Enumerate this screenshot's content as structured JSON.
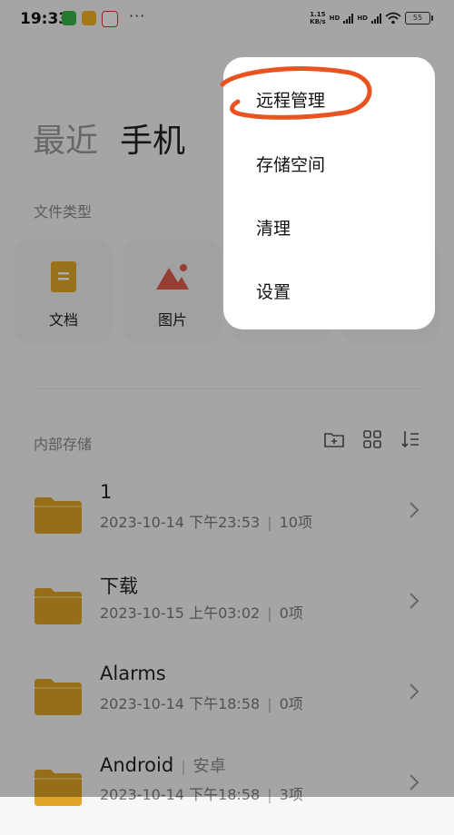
{
  "status_bar": {
    "time": "19:33",
    "more": "···",
    "speed_value": "1.15",
    "speed_unit": "KB/s",
    "hd1": "HD",
    "hd2": "HD",
    "battery": "55",
    "app_icons": [
      "wechat-icon",
      "notes-app-icon",
      "taobao-icon"
    ]
  },
  "nav": {
    "tabs": [
      "最近",
      "手机"
    ],
    "active_index": 1
  },
  "file_types": {
    "label": "文件类型",
    "items": [
      {
        "label": "文档",
        "icon": "document-icon"
      },
      {
        "label": "图片",
        "icon": "image-icon"
      }
    ]
  },
  "storage": {
    "label": "内部存储"
  },
  "files": [
    {
      "name": "1",
      "tag": "",
      "date": "2023-10-14 下午23:53",
      "count": "10项"
    },
    {
      "name": "下载",
      "tag": "",
      "date": "2023-10-15 上午03:02",
      "count": "0项"
    },
    {
      "name": "Alarms",
      "tag": "",
      "date": "2023-10-14 下午18:58",
      "count": "0项"
    },
    {
      "name": "Android",
      "tag": "安卓",
      "date": "2023-10-14 下午18:58",
      "count": "3项"
    }
  ],
  "menu": {
    "items": [
      "远程管理",
      "存储空间",
      "清理",
      "设置"
    ],
    "highlighted_index": 0
  },
  "colors": {
    "folder": "#E0A526",
    "doc_icon": "#E5A928",
    "image_icon": "#E05C4E",
    "annotation": "#E8531F",
    "overlay": "rgba(0,0,0,0.33)"
  }
}
